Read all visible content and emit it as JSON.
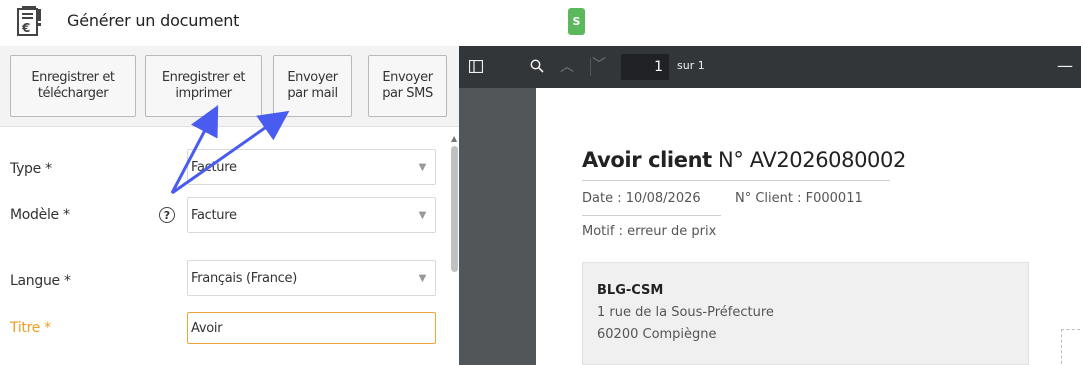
{
  "header": {
    "title": "Générer un document",
    "user_badge": "S",
    "icon": "invoice-euro-icon"
  },
  "actions": {
    "save_download": "Enregistrer et\ntélécharger",
    "save_print": "Enregistrer et\nimprimer",
    "send_mail": "Envoyer\npar mail",
    "send_sms": "Envoyer\npar SMS"
  },
  "form": {
    "type_label": "Type *",
    "type_value": "Facture",
    "model_label": "Modèle *",
    "model_value": "Facture",
    "help_icon": "?",
    "lang_label": "Langue *",
    "lang_value": "Français (France)",
    "title_label": "Titre *",
    "title_value": "Avoir"
  },
  "viewer": {
    "page_current": "1",
    "page_total": "sur 1"
  },
  "document": {
    "title_bold": "Avoir client",
    "title_number": "N° AV2026080002",
    "date": "Date : 10/08/2026",
    "client": "N° Client : F000011",
    "motif": "Motif : erreur de prix",
    "company": "BLG-CSM",
    "address_line1": "1 rue de la Sous-Préfecture",
    "address_line2": "60200 Compiègne"
  },
  "colors": {
    "accent_orange": "#f29c1f",
    "annotation_arrow": "#4a5cf0",
    "badge_green": "#5cb85c"
  }
}
